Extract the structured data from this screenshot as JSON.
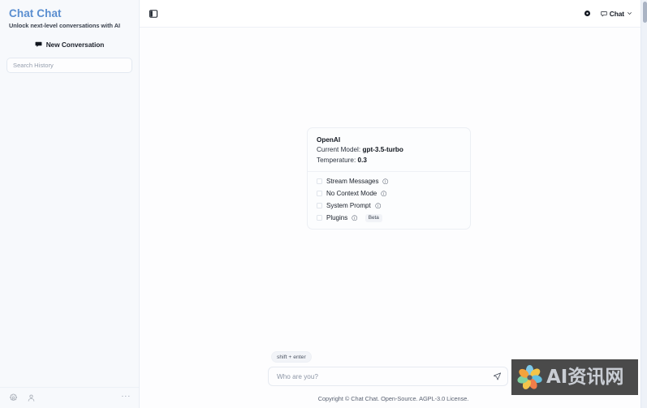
{
  "sidebar": {
    "title": "Chat Chat",
    "tagline": "Unlock next-level conversations with AI",
    "new_conversation_label": "New Conversation",
    "search_placeholder": "Search History",
    "search_value": "",
    "footer": {
      "settings_icon": "gear-icon",
      "account_icon": "user-icon",
      "more_label": "···"
    }
  },
  "topbar": {
    "panel_toggle_icon": "panel-toggle-icon",
    "settings_icon": "gear-icon",
    "mode_label": "Chat",
    "mode_icon": "chat-bubble-icon",
    "chevron_icon": "chevron-down-icon"
  },
  "settings_card": {
    "provider": "OpenAI",
    "model_label": "Current Model:",
    "model_value": "gpt-3.5-turbo",
    "temperature_label": "Temperature:",
    "temperature_value": "0.3",
    "options": [
      {
        "label": "Stream Messages",
        "checked": false,
        "info_icon": "info-icon",
        "badge": ""
      },
      {
        "label": "No Context Mode",
        "checked": false,
        "info_icon": "info-icon",
        "badge": ""
      },
      {
        "label": "System Prompt",
        "checked": false,
        "info_icon": "info-icon",
        "badge": ""
      },
      {
        "label": "Plugins",
        "checked": false,
        "info_icon": "info-icon",
        "badge": "Beta"
      }
    ]
  },
  "composer": {
    "hint_badge": "shift + enter",
    "input_placeholder": "Who are you?",
    "input_value": "",
    "send_icon": "send-icon"
  },
  "footer": {
    "copyright": "Copyright © Chat Chat. Open-Source. AGPL-3.0 License."
  },
  "watermark": {
    "text": "AI资讯网",
    "logo_icon": "flower-logo-icon"
  },
  "colors": {
    "brand_blue": "#5a8ed0",
    "sidebar_bg": "#f7f9fc",
    "main_bg": "#fdfdfe",
    "border": "#e9eef5",
    "text_dark": "#141922"
  }
}
